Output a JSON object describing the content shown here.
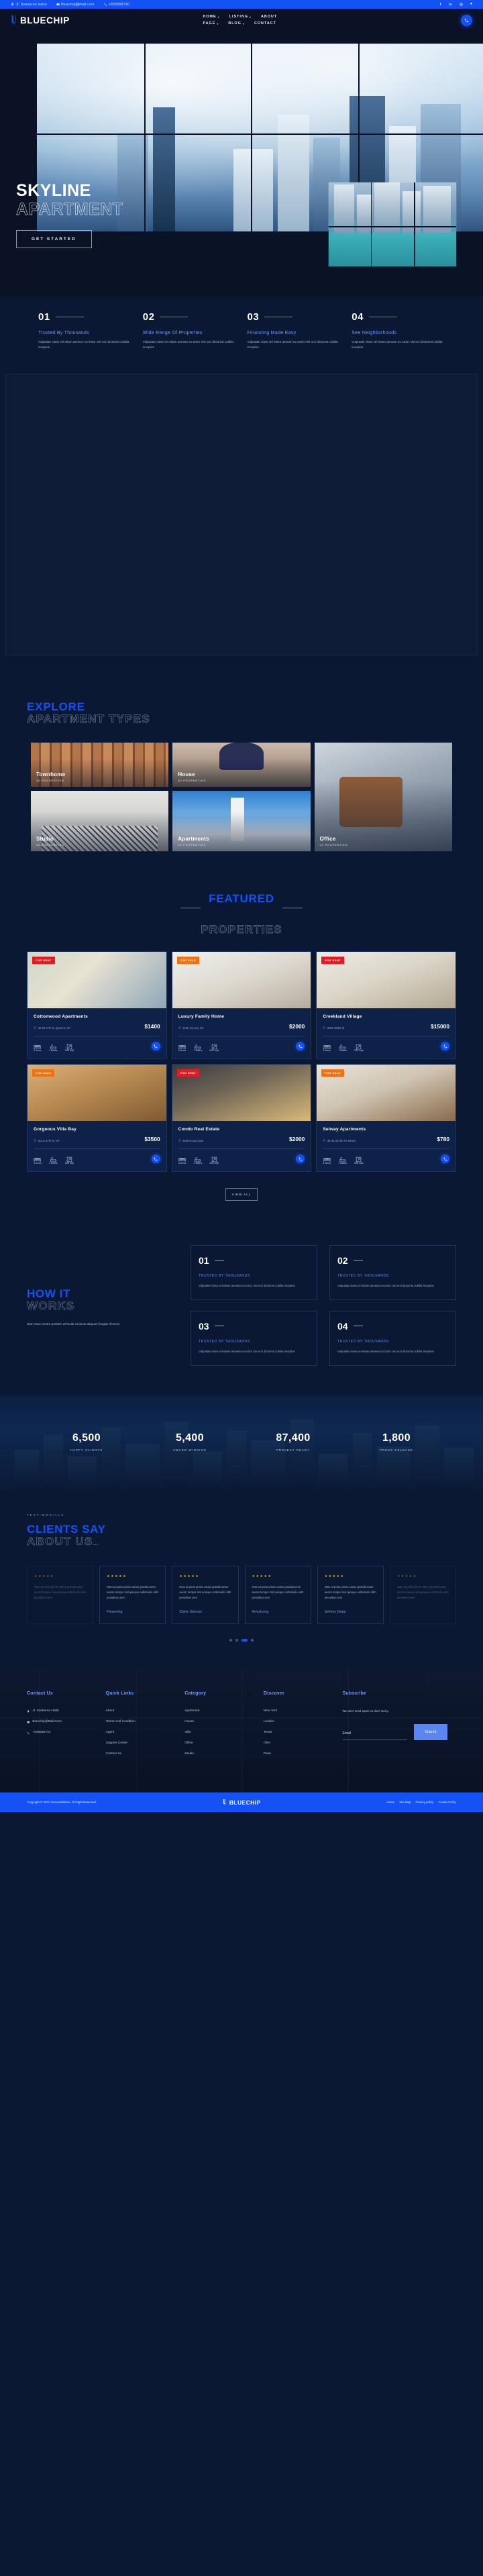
{
  "topbar": {
    "address": "Jl. Soekarno Hatta",
    "email": "Bluechip@mail.com",
    "phone": "+625558710",
    "socials": [
      "facebook-icon",
      "linkedin-icon",
      "instagram-icon",
      "behance-icon"
    ]
  },
  "header": {
    "brand": "BLUECHIP",
    "nav_row1": [
      "HOME",
      "LISTING",
      "ABOUT"
    ],
    "nav_row2": [
      "PAGE",
      "BLOG",
      "CONTACT"
    ],
    "call_button": "phone-icon"
  },
  "hero": {
    "title_line1": "SKYLINE",
    "title_line2": "APARTMENT",
    "cta": "GET STARTED"
  },
  "features": [
    {
      "num": "01",
      "title": "Trusted By Thousands",
      "text": "Vulputate class vel etiam aenean eu tortor nisl orci dictumst cubilia inceptos"
    },
    {
      "num": "02",
      "title": "Wide Renge Of Properties",
      "text": "Vulputate class vel etiam aenean eu tortor nisl orci dictumst cubilia inceptos"
    },
    {
      "num": "03",
      "title": "Financing Made Easy",
      "text": "Vulputate class vel etiam aenean eu tortor nisl orci dictumst cubilia inceptos"
    },
    {
      "num": "04",
      "title": "See Neighborhoods",
      "text": "Vulputate class vel etiam aenean eu tortor nisl orci dictumst cubilia inceptos"
    }
  ],
  "explore": {
    "title_line1": "EXPLORE",
    "title_line2": "APARTMENT TYPES",
    "types": [
      {
        "name": "Townhome",
        "count": "20 PROPERTIES"
      },
      {
        "name": "House",
        "count": "60 PROPERTIES"
      },
      {
        "name": "Office",
        "count": "20 PROPERTIES"
      },
      {
        "name": "Studio",
        "count": "60 PROPERTIES"
      },
      {
        "name": "Apartments",
        "count": "20 PROPERTIES"
      }
    ]
  },
  "featured": {
    "title_line1": "FEATURED",
    "title_line2": "PROPERTIES",
    "view_all": "VIEW ALL",
    "properties": [
      {
        "badge": "FOR RENT",
        "badge_type": "rent",
        "name": "Cottonwood Apartments",
        "address": "35-60 17th St, Queens, NY",
        "price": "$1400",
        "beds": "4 Beds",
        "baths": "1 Baths",
        "area": "525 sqft"
      },
      {
        "badge": "FOR SALE",
        "badge_type": "sale",
        "name": "Luxury Family Home",
        "address": "1239 1st Ave, NY",
        "price": "$2000",
        "beds": "4 Beds",
        "baths": "1 Baths",
        "area": "525 sqft"
      },
      {
        "badge": "FOR RENT",
        "badge_type": "rent",
        "name": "Creekland Village",
        "address": "5051 Bellot St",
        "price": "$15000",
        "beds": "4 Beds",
        "baths": "1 Baths",
        "area": "525 sqft"
      },
      {
        "badge": "FOR SALE",
        "badge_type": "sale",
        "name": "Gorgeous Villa Bay",
        "address": "411 E 67th St, NY",
        "price": "$3500",
        "beds": "4 Beds",
        "baths": "1 Baths",
        "area": "525 sqft"
      },
      {
        "badge": "FOR RENT",
        "badge_type": "rent",
        "name": "Condo Real Estate",
        "address": "3599 Huntz Lane",
        "price": "$2000",
        "beds": "4 Beds",
        "baths": "1 Baths",
        "area": "525 sqft"
      },
      {
        "badge": "FOR SALE",
        "badge_type": "sale",
        "name": "Selway Apartments",
        "address": "36-46 SE 9th St, Miami",
        "price": "$780",
        "beds": "4 Beds",
        "baths": "1 Baths",
        "area": "525 sqft"
      }
    ]
  },
  "how": {
    "title_line1": "HOW IT",
    "title_line2": "WORKS",
    "text": "Nam risus ornare porttitor vehicula vivamus aliquam feugiat rhoncus",
    "steps": [
      {
        "num": "01",
        "title": "TRUSTED BY THOUSANDS",
        "text": "Vulputate class vel etiam aenean eu tortor nisi orci dictumst cubilia inceptos"
      },
      {
        "num": "02",
        "title": "TRUSTED BY THOUSANDS",
        "text": "Vulputate class vel etiam aenean eu tortor nisi orci dictumst cubilia inceptos"
      },
      {
        "num": "03",
        "title": "TRUSTED BY THOUSANDS",
        "text": "Vulputate class vel etiam aenean eu tortor nisi orci dictumst cubilia inceptos"
      },
      {
        "num": "04",
        "title": "TRUSTED BY THOUSANDS",
        "text": "Vulputate class vel etiam aenean eu tortor nisi orci dictumst cubilia inceptos"
      }
    ]
  },
  "stats": [
    {
      "value": "6,500",
      "label": "HAPPY CLIENTS"
    },
    {
      "value": "5,400",
      "label": "AWARD WINNING"
    },
    {
      "value": "87,400",
      "label": "PROJECT READY"
    },
    {
      "value": "1,800",
      "label": "PRESS RELEASE"
    }
  ],
  "testimonials": {
    "eyebrow": "TESTIMONIALS",
    "title_line1": "CLIENTS SAY",
    "title_line2": "ABOUT US",
    "items": [
      {
        "stars": "★★★★★",
        "text": "Nam at porta primis varius gravida tortor auctor tempor nisl quisque sollicitudin nibh penatibus sem",
        "author": ""
      },
      {
        "stars": "★★★★★",
        "text": "Nam at porta primis varius gravida tortor auctor tempor nisl quisque sollicitudin nibh penatibus sem",
        "author": "Flowering"
      },
      {
        "stars": "★★★★★",
        "text": "Nam at porta primis varius gravida tortor auctor tempor nisl quisque sollicitudin nibh penatibus sem",
        "author": "Claire Skinner"
      },
      {
        "stars": "★★★★★",
        "text": "Nam at porta primis varius gravida tortor auctor tempor nisl quisque sollicitudin nibh penatibus sem",
        "author": "Armstrong"
      },
      {
        "stars": "★★★★★",
        "text": "Nam at porta primis varius gravida tortor auctor tempor nisl quisque sollicitudin nibh penatibus sem",
        "author": "Johnny Depp"
      },
      {
        "stars": "★★★★★",
        "text": "Nam at porta primis varius gravida tortor auctor tempor nisl quisque sollicitudin nibh penatibus sem",
        "author": ""
      }
    ]
  },
  "footer": {
    "contact": {
      "heading": "Contact Us",
      "address": "Jl. Soekarno Hatta",
      "email": "Bluechip@Mail.Com",
      "phone": "+625558710"
    },
    "quick_links": {
      "heading": "Quick Links",
      "items": [
        "About",
        "Terms And Condition",
        "Agent",
        "Support Center",
        "Contact Us"
      ]
    },
    "category": {
      "heading": "Category",
      "items": [
        "Apartment",
        "House",
        "Villa",
        "Office",
        "Studio"
      ]
    },
    "discover": {
      "heading": "Discover",
      "items": [
        "New York",
        "London",
        "Texas",
        "Ohio",
        "Paris"
      ]
    },
    "subscribe": {
      "heading": "Subscribe",
      "note": "We don't send spam so don't worry.",
      "placeholder": "Email",
      "button": "Submit"
    },
    "copyright": "Copyright © 2021 Onecontributor. All Right Reserved.",
    "brand": "BLUECHIP",
    "bottom_links": [
      "Home",
      "Site Map",
      "Privacy policy",
      "Cookie Policy"
    ]
  },
  "colors": {
    "brand_blue": "#1452f5",
    "dark_navy": "#0a1833",
    "rent_red": "#e01b24",
    "sale_orange": "#ee7312"
  }
}
